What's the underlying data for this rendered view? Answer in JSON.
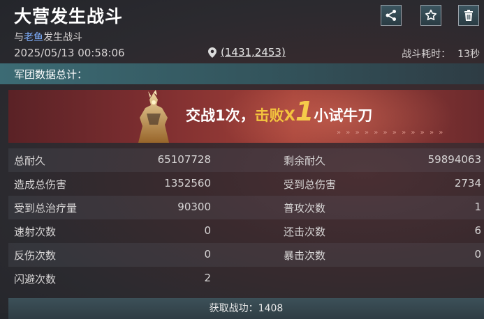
{
  "header": {
    "title": "大营发生战斗",
    "subtitle_prefix": "与",
    "enemy_name": "老鱼",
    "subtitle_suffix": "发生战斗",
    "datetime": "2025/05/13  00:58:06",
    "location": "(1431,2453)",
    "duration_label": "战斗耗时：",
    "duration_value": "13秒",
    "icons": [
      "share-icon",
      "star-icon",
      "trash-icon"
    ]
  },
  "section": {
    "title": "军团数据总计："
  },
  "banner": {
    "prefix": "交战1次，",
    "defeat_label": "击败X",
    "defeat_count": "1",
    "target": "小试牛刀",
    "chevrons": "» » » » » » » » » » » »"
  },
  "stats": [
    {
      "left_label": "总耐久",
      "left_value": "65107728",
      "right_label": "剩余耐久",
      "right_value": "59894063"
    },
    {
      "left_label": "造成总伤害",
      "left_value": "1352560",
      "right_label": "受到总伤害",
      "right_value": "2734"
    },
    {
      "left_label": "受到总治疗量",
      "left_value": "90300",
      "right_label": "普攻次数",
      "right_value": "1"
    },
    {
      "left_label": "速射次数",
      "left_value": "0",
      "right_label": "还击次数",
      "right_value": "6"
    },
    {
      "left_label": "反伤次数",
      "left_value": "0",
      "right_label": "暴击次数",
      "right_value": "0"
    },
    {
      "left_label": "闪避次数",
      "left_value": "2",
      "right_label": "",
      "right_value": ""
    }
  ],
  "footer": {
    "text": "获取战功：1408"
  },
  "colors": {
    "accent_teal": "#3c6b74",
    "enemy_blue": "#7fb0ff",
    "gold": "#f3c43e",
    "banner_red": "#7d2e30"
  }
}
